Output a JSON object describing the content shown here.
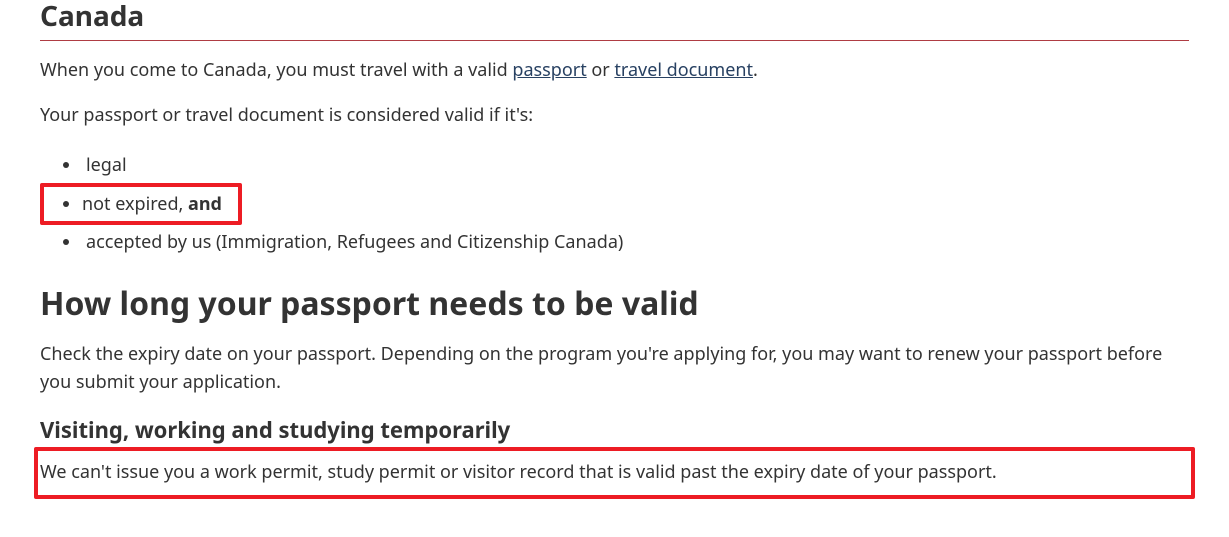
{
  "title": "Canada",
  "intro": {
    "prefix": "When you come to Canada, you must travel with a valid ",
    "link1": "passport",
    "mid": " or ",
    "link2": "travel document",
    "suffix": "."
  },
  "validIf": "Your passport or travel document is considered valid if it's:",
  "bullets": {
    "b1": "legal",
    "b2_text": "not expired, ",
    "b2_bold": "and",
    "b3": "accepted by us (Immigration, Refugees and Citizenship Canada)"
  },
  "howLong": {
    "heading": "How long your passport needs to be valid",
    "para": "Check the expiry date on your passport. Depending on the program you're applying for, you may want to renew your passport before you submit your application."
  },
  "temp": {
    "heading": "Visiting, working and studying temporarily",
    "para": "We can't issue you a work permit, study permit or visitor record that is valid past the expiry date of your passport."
  }
}
